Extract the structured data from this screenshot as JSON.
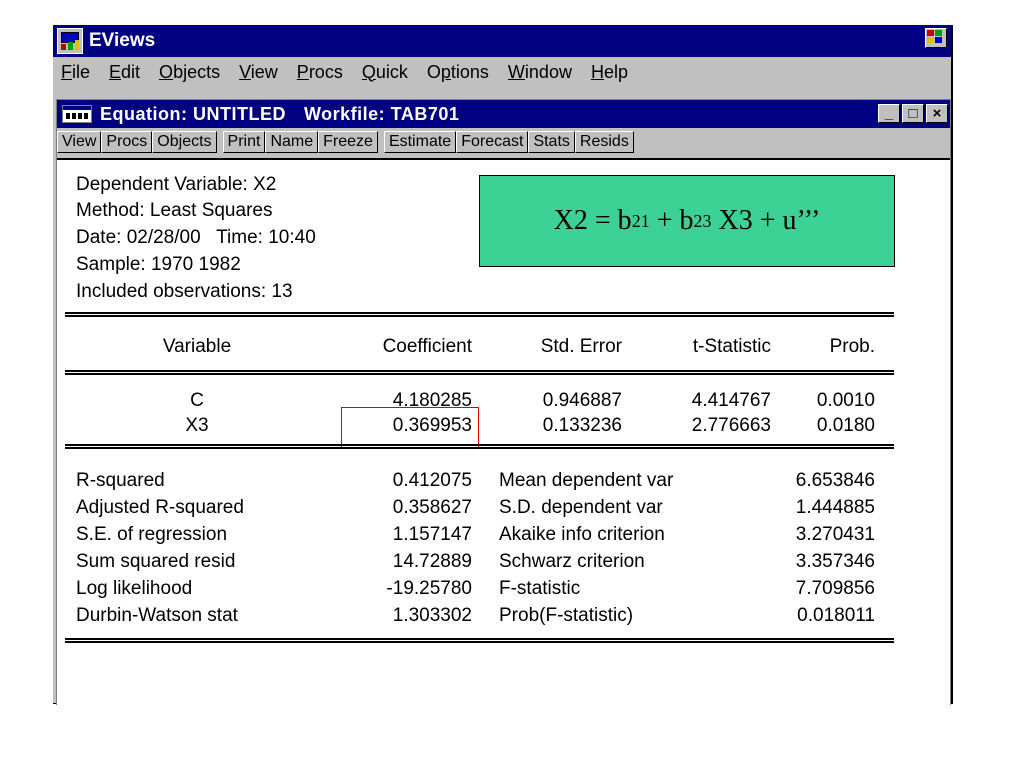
{
  "app": {
    "title": "EViews",
    "menu": [
      "File",
      "Edit",
      "Objects",
      "View",
      "Procs",
      "Quick",
      "Options",
      "Window",
      "Help"
    ],
    "menu_underline": [
      "F",
      "E",
      "O",
      "V",
      "P",
      "Q",
      "p",
      "W",
      "H"
    ]
  },
  "window": {
    "title_part1": "Equation: UNTITLED",
    "title_part2": "Workfile: TAB701",
    "buttons": {
      "minimize": "_",
      "maximize": "□",
      "close": "×"
    },
    "toolbar": [
      "View",
      "Procs",
      "Objects",
      "Print",
      "Name",
      "Freeze",
      "Estimate",
      "Forecast",
      "Stats",
      "Resids"
    ]
  },
  "output": {
    "header": [
      "Dependent Variable: X2",
      "Method: Least Squares",
      "Date: 02/28/00   Time: 10:40",
      "Sample: 1970 1982",
      "Included observations: 13"
    ],
    "equation": {
      "lhs": "X2 = b",
      "s1": "21",
      "mid": " + b",
      "s2": "23",
      "rhs": " X3 + u’’’"
    },
    "columns": [
      "Variable",
      "Coefficient",
      "Std. Error",
      "t-Statistic",
      "Prob."
    ],
    "rows": [
      {
        "variable": "C",
        "coefficient": "4.180285",
        "std_error": "0.946887",
        "t_statistic": "4.414767",
        "prob": "0.0010"
      },
      {
        "variable": "X3",
        "coefficient": "0.369953",
        "std_error": "0.133236",
        "t_statistic": "2.776663",
        "prob": "0.0180"
      }
    ],
    "stats_left": [
      {
        "label": "R-squared",
        "value": "0.412075"
      },
      {
        "label": "Adjusted R-squared",
        "value": "0.358627"
      },
      {
        "label": "S.E. of regression",
        "value": "1.157147"
      },
      {
        "label": "Sum squared resid",
        "value": "14.72889"
      },
      {
        "label": "Log likelihood",
        "value": "-19.25780"
      },
      {
        "label": "Durbin-Watson stat",
        "value": "1.303302"
      }
    ],
    "stats_right": [
      {
        "label": "Mean dependent var",
        "value": "6.653846"
      },
      {
        "label": "S.D. dependent var",
        "value": "1.444885"
      },
      {
        "label": "Akaike info criterion",
        "value": "3.270431"
      },
      {
        "label": "Schwarz criterion",
        "value": "3.357346"
      },
      {
        "label": "F-statistic",
        "value": "7.709856"
      },
      {
        "label": "Prob(F-statistic)",
        "value": "0.018011"
      }
    ]
  },
  "colors": {
    "titlebar": "#000080",
    "equation_box": "#3cd296",
    "highlight": "#e00000"
  }
}
